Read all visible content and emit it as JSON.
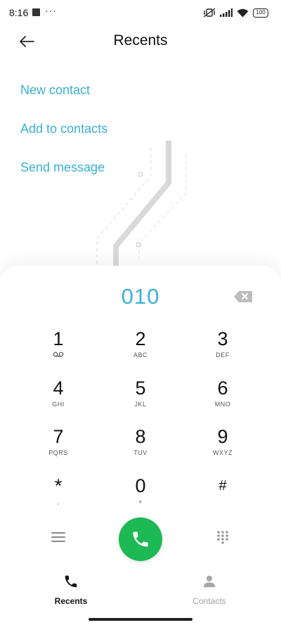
{
  "status_bar": {
    "time": "8:16",
    "more_dots": "···",
    "battery": "100",
    "icons": [
      "square-notification-icon",
      "vibrate-off-icon",
      "signal-icon",
      "wifi-icon",
      "battery-icon"
    ]
  },
  "header": {
    "title": "Recents",
    "back_icon": "arrow-left-icon"
  },
  "actions": {
    "new_contact": "New contact",
    "add_to_contacts": "Add to contacts",
    "send_message": "Send message"
  },
  "dialpad": {
    "display_number": "010",
    "keys": [
      {
        "digit": "1",
        "letters": ""
      },
      {
        "digit": "2",
        "letters": "ABC"
      },
      {
        "digit": "3",
        "letters": "DEF"
      },
      {
        "digit": "4",
        "letters": "GHI"
      },
      {
        "digit": "5",
        "letters": "JKL"
      },
      {
        "digit": "6",
        "letters": "MNO"
      },
      {
        "digit": "7",
        "letters": "PQRS"
      },
      {
        "digit": "8",
        "letters": "TUV"
      },
      {
        "digit": "9",
        "letters": "WXYZ"
      },
      {
        "digit": "*",
        "letters": ","
      },
      {
        "digit": "0",
        "letters": "+"
      },
      {
        "digit": "#",
        "letters": ""
      }
    ]
  },
  "colors": {
    "accent": "#3ab0d6",
    "call_green": "#1db954"
  },
  "bottom_nav": {
    "tabs": [
      {
        "label": "Recents",
        "active": true
      },
      {
        "label": "Contacts",
        "active": false
      }
    ]
  }
}
